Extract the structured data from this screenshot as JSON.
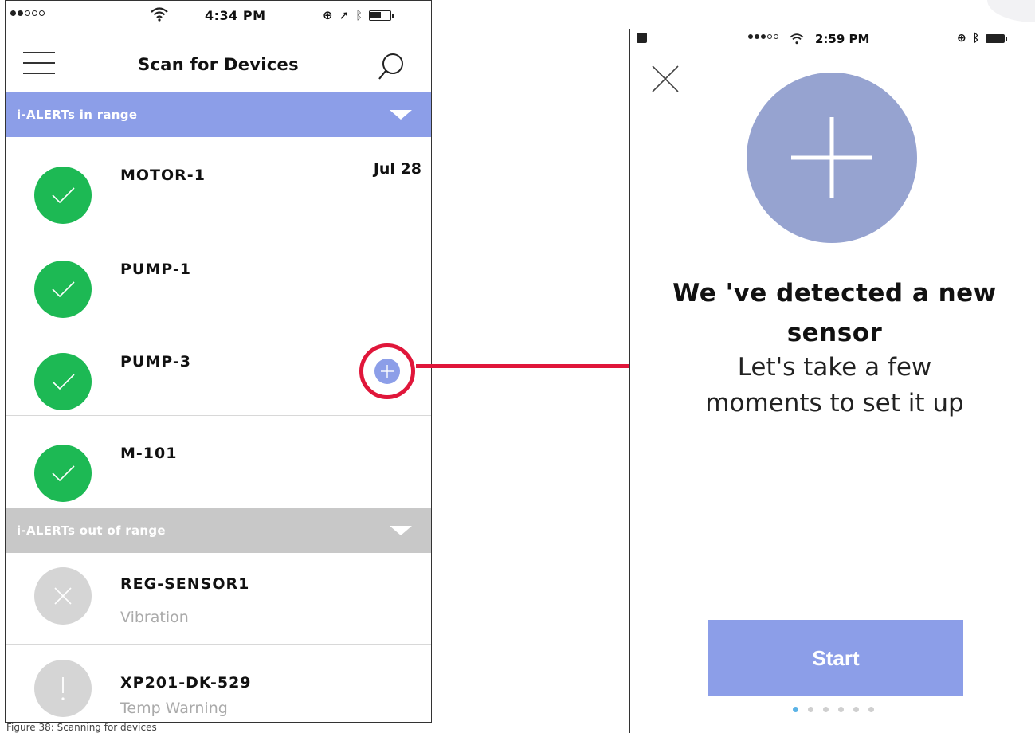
{
  "left_screen": {
    "status_bar": {
      "time": "4:34 PM"
    },
    "nav": {
      "title": "Scan for Devices",
      "menu_icon": "hamburger-icon",
      "search_icon": "search-icon"
    },
    "sections": {
      "in_range": {
        "label": "i-ALERTs in range"
      },
      "out_of_range": {
        "label": "i-ALERTs out of range"
      }
    },
    "devices_in_range": [
      {
        "name": "MOTOR-1",
        "date": "Jul 28",
        "status": "check-icon"
      },
      {
        "name": "PUMP-1",
        "status": "check-icon"
      },
      {
        "name": "PUMP-3",
        "status": "check-icon",
        "action": "add-icon"
      },
      {
        "name": "M-101",
        "status": "check-icon"
      }
    ],
    "devices_out_of_range": [
      {
        "name": "REG-SENSOR1",
        "subtitle": "Vibration",
        "status": "x-icon"
      },
      {
        "name": "XP201-DK-529",
        "subtitle": "Temp Warning",
        "status": "exclamation-icon"
      }
    ],
    "caption": "Figure 38: Scanning for devices"
  },
  "right_screen": {
    "status_bar": {
      "time": "2:59 PM"
    },
    "headline": "We 've detected a new sensor",
    "subline": "Let's take a few moments to set it up",
    "start_label": "Start",
    "pagination": {
      "total": 6,
      "current": 1
    }
  },
  "colors": {
    "accent": "#8c9ee8",
    "success": "#1db954",
    "highlight": "#e0163a",
    "muted": "#c8c8c8"
  }
}
